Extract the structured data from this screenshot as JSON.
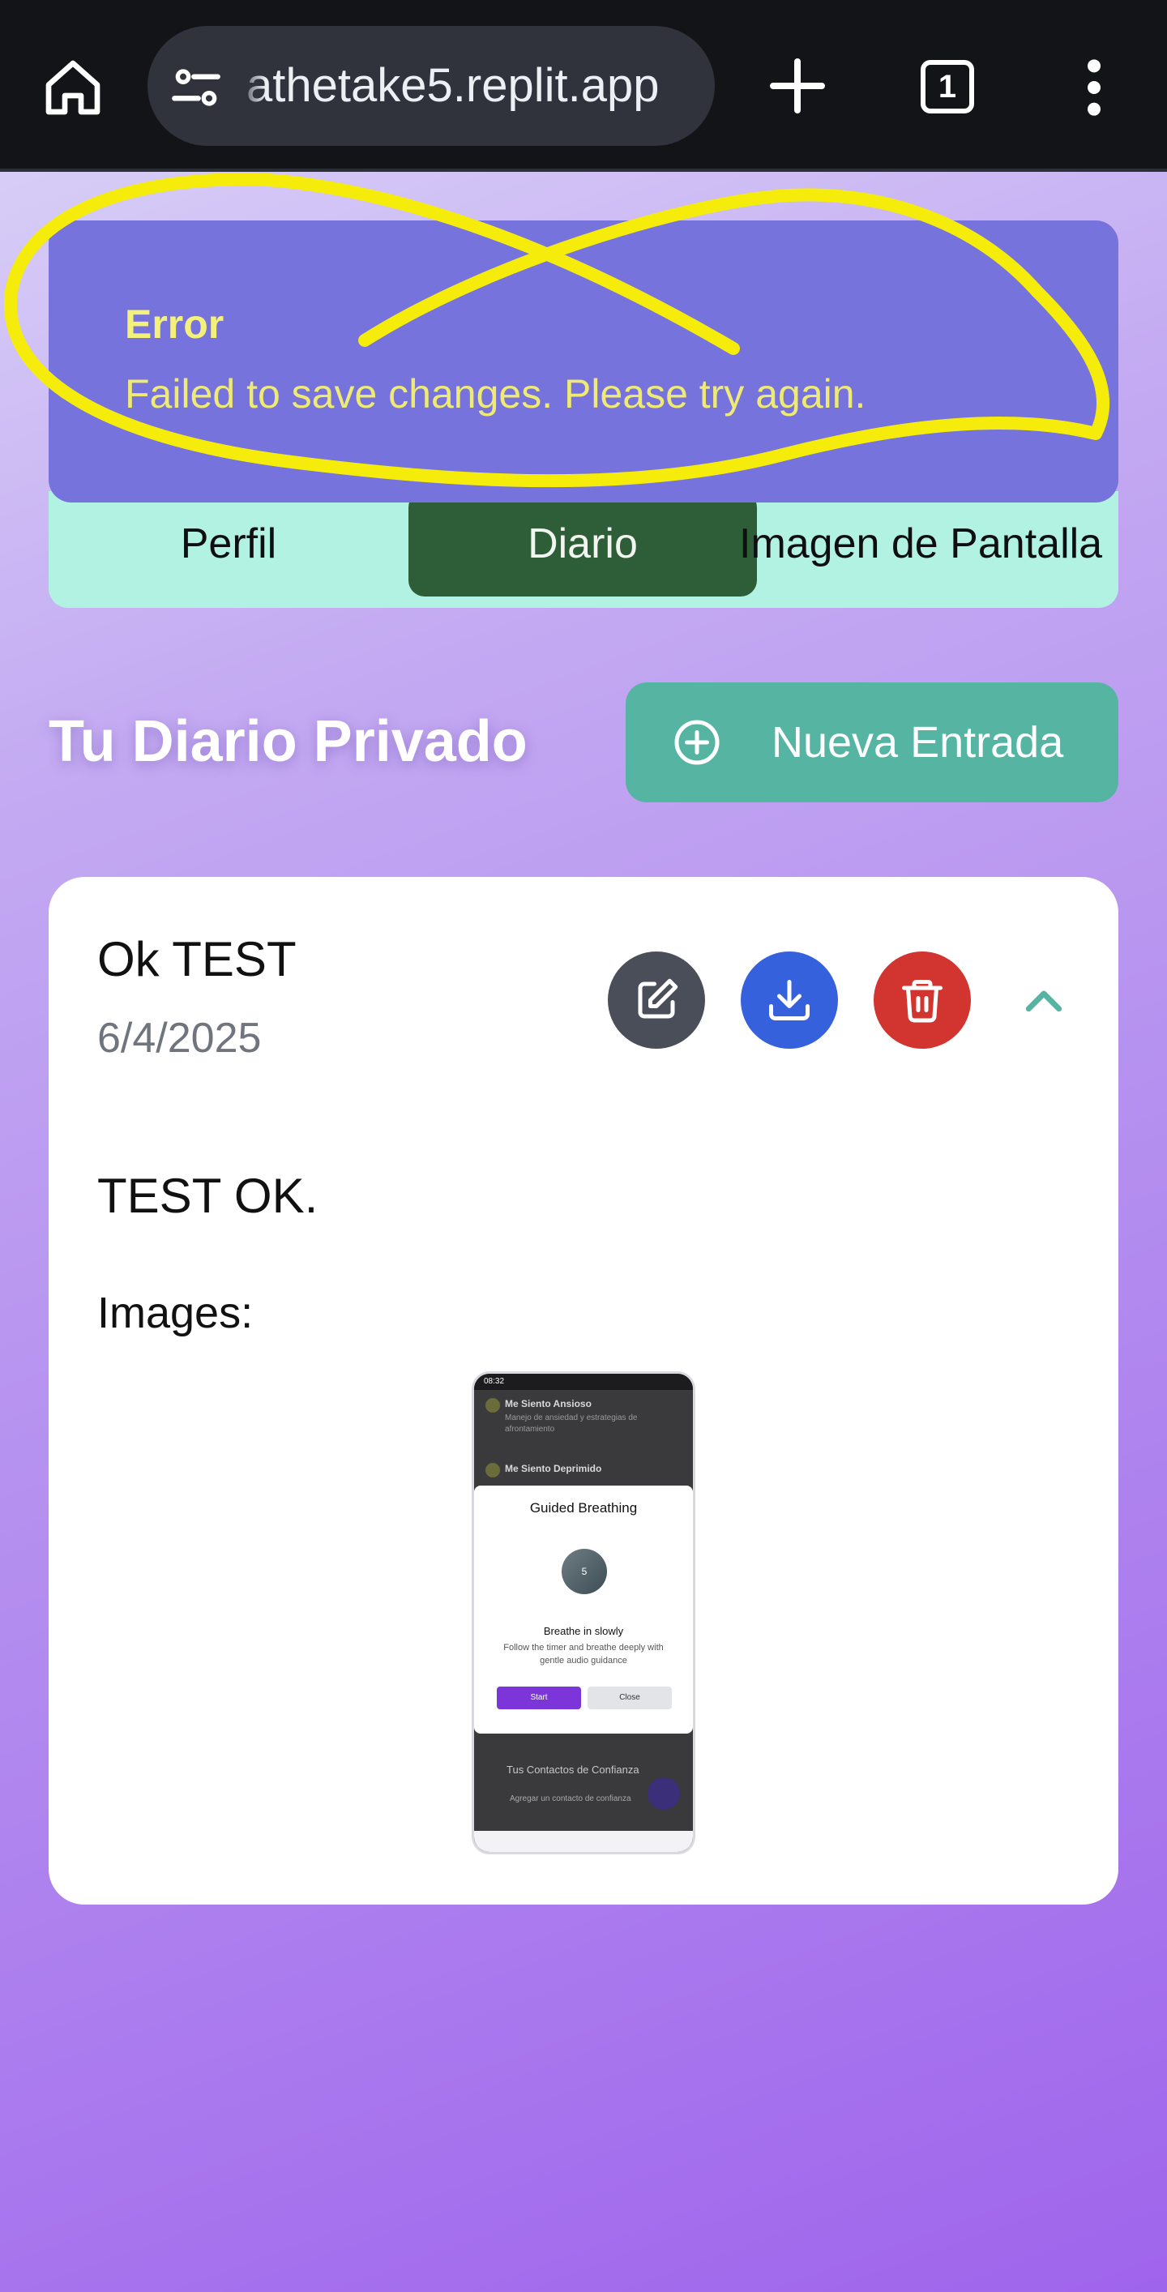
{
  "browser": {
    "url": "athetake5.replit.app",
    "tab_count": "1",
    "icons": [
      "home-icon",
      "tune-icon",
      "plus-icon",
      "tab-switcher-icon",
      "more-vert-icon"
    ]
  },
  "toast": {
    "title": "Error",
    "message": "Failed to save changes. Please try again.",
    "background": "#7673dc",
    "text_color": "#eeea74"
  },
  "tabs": [
    {
      "label": "Perfil",
      "active": false
    },
    {
      "label": "Diario",
      "active": true
    },
    {
      "label": "Imagen de Pantalla",
      "active": false
    }
  ],
  "page": {
    "title": "Tu Diario Privado",
    "new_entry_label": "Nueva Entrada"
  },
  "entry": {
    "title": "Ok TEST",
    "date": "6/4/2025",
    "body": "TEST OK.",
    "images_label": "Images:",
    "actions": [
      "edit-icon",
      "download-icon",
      "trash-icon",
      "chevron-up-icon"
    ],
    "action_colors": {
      "edit": "#4a4e59",
      "download": "#3661dc",
      "delete": "#d2342f"
    }
  },
  "thumbnail": {
    "status_time": "08:32",
    "list_item_1": "Me Siento Ansioso",
    "list_item_1_desc": "Manejo de ansiedad y estrategias de afrontamiento",
    "list_item_2": "Me Siento Deprimido",
    "modal_title": "Guided Breathing",
    "timer_value": "5",
    "modal_subtitle": "Breathe in slowly",
    "modal_desc": "Follow the timer and breathe deeply with gentle audio guidance",
    "start_label": "Start",
    "close_label": "Close",
    "contacts_title": "Tus Contactos de Confianza",
    "contacts_add": "Agregar un contacto de confianza"
  },
  "accent_colors": {
    "tab_bar": "#b2f2e3",
    "active_tab": "#2d5e37",
    "new_entry_button": "#55b4a2",
    "annotation": "#f5ec0c"
  }
}
